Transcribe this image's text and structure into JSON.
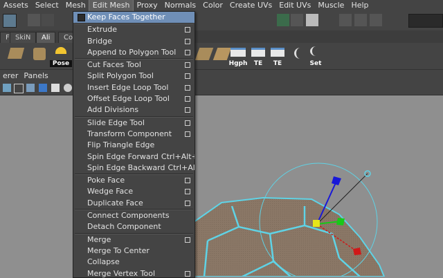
{
  "menubar": {
    "items": [
      "Assets",
      "Select",
      "Mesh",
      "Edit Mesh",
      "Proxy",
      "Normals",
      "Color",
      "Create UVs",
      "Edit UVs",
      "Muscle",
      "Help"
    ],
    "active_index": 3
  },
  "shelf_tabs": [
    "F",
    "SkiN",
    "Ali",
    "Co"
  ],
  "shelf_buttons": [
    "Pose",
    "Hgph",
    "TE",
    "TE",
    "Set"
  ],
  "panel_menu": [
    "erer",
    "Panels"
  ],
  "edit_mesh_menu": {
    "checkbox_item": "Keep Faces Together",
    "groups": [
      [
        {
          "label": "Extrude",
          "option": true
        },
        {
          "label": "Bridge",
          "option": true
        },
        {
          "label": "Append to Polygon Tool",
          "option": true
        }
      ],
      [
        {
          "label": "Cut Faces Tool",
          "option": true
        },
        {
          "label": "Split Polygon Tool",
          "option": true
        },
        {
          "label": "Insert Edge Loop Tool",
          "option": true
        },
        {
          "label": "Offset Edge Loop Tool",
          "option": true
        },
        {
          "label": "Add Divisions",
          "option": true
        }
      ],
      [
        {
          "label": "Slide Edge Tool",
          "option": true
        },
        {
          "label": "Transform Component",
          "option": true
        },
        {
          "label": "Flip Triangle Edge",
          "option": false
        },
        {
          "label": "Spin Edge Forward",
          "shortcut": "Ctrl+Alt+Right",
          "option": false
        },
        {
          "label": "Spin Edge Backward",
          "shortcut": "Ctrl+Alt+Left",
          "option": false
        }
      ],
      [
        {
          "label": "Poke Face",
          "option": true
        },
        {
          "label": "Wedge Face",
          "option": true
        },
        {
          "label": "Duplicate Face",
          "option": true
        }
      ],
      [
        {
          "label": "Connect Components",
          "option": false
        },
        {
          "label": "Detach Component",
          "option": false
        }
      ],
      [
        {
          "label": "Merge",
          "option": true
        },
        {
          "label": "Merge To Center",
          "option": false
        },
        {
          "label": "Collapse",
          "option": false
        },
        {
          "label": "Merge Vertex Tool",
          "option": true
        }
      ]
    ]
  },
  "colors": {
    "menu_bg": "#444444",
    "highlight": "#6f8fb7",
    "viewport_bg": "#8f8f8f",
    "mesh_face": "#8a7766",
    "mesh_edge": "#5fd3e6",
    "manipulator_x": "#d01818",
    "manipulator_y": "#18c818",
    "manipulator_z": "#1818d8",
    "manipulator_center": "#e6e61a"
  }
}
